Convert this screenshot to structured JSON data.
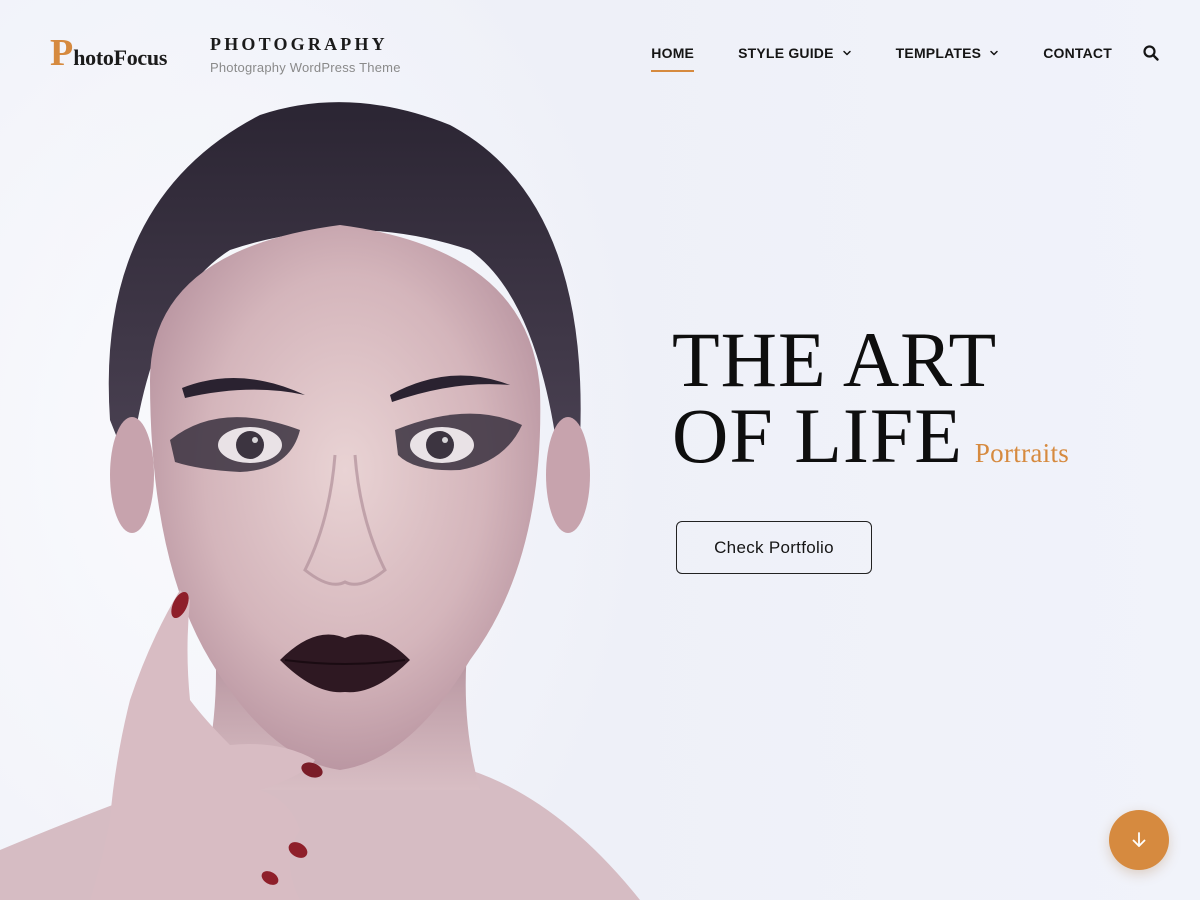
{
  "brand": {
    "logo_initial": "P",
    "logo_rest": "hotoFocus",
    "site_title": "PHOTOGRAPHY",
    "tagline": "Photography WordPress Theme",
    "accent_color": "#d68a3f"
  },
  "nav": {
    "items": [
      {
        "label": "HOME",
        "active": true,
        "has_dropdown": false
      },
      {
        "label": "STYLE GUIDE",
        "active": false,
        "has_dropdown": true
      },
      {
        "label": "TEMPLATES",
        "active": false,
        "has_dropdown": true
      },
      {
        "label": "CONTACT",
        "active": false,
        "has_dropdown": false
      }
    ],
    "search_icon": "search-icon"
  },
  "hero": {
    "line1": "THE ART",
    "line2": "OF LIFE",
    "subtitle": "Portraits",
    "cta_label": "Check Portfolio",
    "scroll_icon": "arrow-down-icon"
  }
}
